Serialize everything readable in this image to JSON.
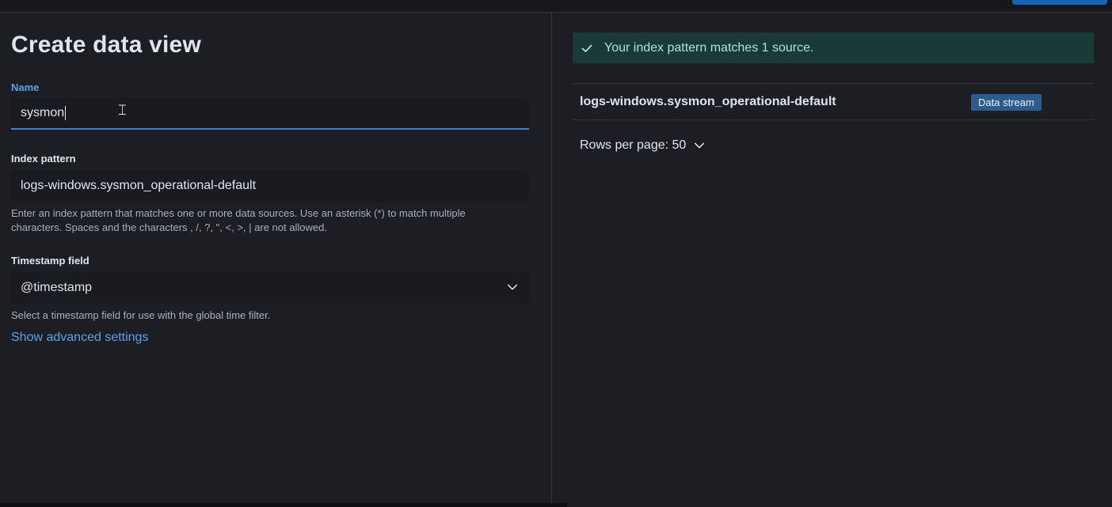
{
  "page": {
    "title": "Create data view"
  },
  "form": {
    "name_label": "Name",
    "name_value": "sysmon",
    "index_pattern_label": "Index pattern",
    "index_pattern_value": "logs-windows.sysmon_operational-default",
    "index_pattern_help_line1": "Enter an index pattern that matches one or more data sources. Use an asterisk (*) to match multiple",
    "index_pattern_help_line2": "characters. Spaces and the characters , /, ?, \", <, >, | are not allowed.",
    "timestamp_label": "Timestamp field",
    "timestamp_value": "@timestamp",
    "timestamp_help": "Select a timestamp field for use with the global time filter.",
    "advanced_link": "Show advanced settings"
  },
  "results": {
    "callout_text": "Your index pattern matches 1 source.",
    "rows": [
      {
        "name": "logs-windows.sysmon_operational-default",
        "badge": "Data stream"
      }
    ],
    "rows_per_page": "Rows per page: 50"
  },
  "colors": {
    "background": "#1d1e24",
    "accent": "#5aa3ec",
    "success_bg": "#1a3a38",
    "success_text": "#a8e4dc",
    "badge_bg": "#2c5c8f"
  },
  "icons": {
    "callout": "check-icon",
    "select": "chevron-down-icon",
    "pagination": "chevron-down-icon",
    "cursor": "text-cursor-icon"
  }
}
